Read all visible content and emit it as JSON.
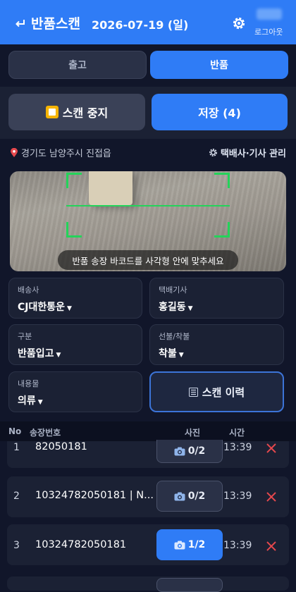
{
  "header": {
    "title": "반품스캔",
    "date": "2026-07-19 (일)",
    "logout_label": "로그아웃"
  },
  "mode_tabs": [
    {
      "label": "출고",
      "active": false
    },
    {
      "label": "반품",
      "active": true
    }
  ],
  "actions": {
    "stop_label": "스캔 중지",
    "save_label": "저장 (4)"
  },
  "location": {
    "text": "경기도 남양주시 진접읍",
    "manage_label": "택배사·기사 관리"
  },
  "camera": {
    "hint": "반품 송장 바코드를 사각형 안에 맞추세요"
  },
  "fields": {
    "carrier": {
      "label": "배송사",
      "value": "CJ대한통운"
    },
    "driver": {
      "label": "택배기사",
      "value": "홍길동"
    },
    "category": {
      "label": "구분",
      "value": "반품입고"
    },
    "payment": {
      "label": "선불/착불",
      "value": "착불"
    },
    "content": {
      "label": "내용물",
      "value": "의류"
    }
  },
  "history_label": "스캔 이력",
  "table": {
    "headers": {
      "no": "No",
      "invoice": "송장번호",
      "photo": "사진",
      "time": "시간"
    },
    "rows": [
      {
        "no": "1",
        "invoice": "82050181",
        "photo": "0/2",
        "time": "13:39"
      },
      {
        "no": "2",
        "invoice": "10324782050181 | N...",
        "photo": "0/2",
        "time": "13:39"
      },
      {
        "no": "3",
        "invoice": "10324782050181",
        "photo": "1/2",
        "time": "13:39"
      }
    ]
  },
  "colors": {
    "accent": "#2f7cf6",
    "background": "#11162a",
    "scan_frame": "#24d35a",
    "delete": "#e5484d"
  }
}
